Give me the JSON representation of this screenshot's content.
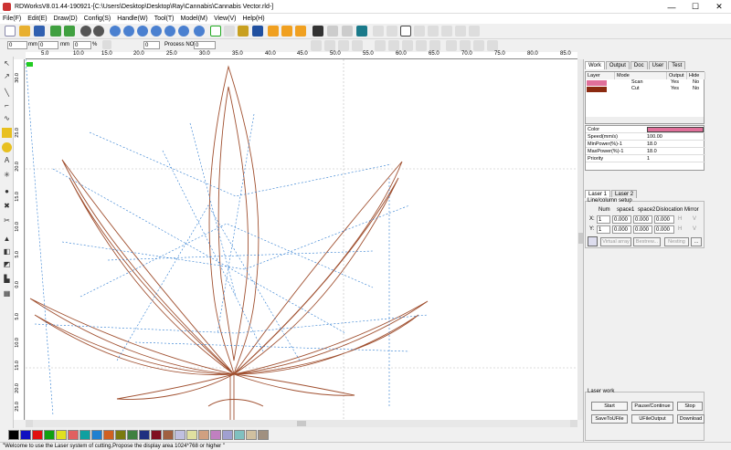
{
  "window": {
    "title": "RDWorksV8.01.44-190921-[C:\\Users\\Desktop\\Desktop\\Ray\\Cannabis\\Cannabis Vector.rld-]",
    "minimize": "—",
    "maximize": "☐",
    "close": "✕"
  },
  "menu": [
    "File(F)",
    "Edit(E)",
    "Draw(D)",
    "Config(S)",
    "Handle(W)",
    "Tool(T)",
    "Model(M)",
    "View(V)",
    "Help(H)"
  ],
  "toolbar2": {
    "unit_mm": "mm",
    "pct": "%",
    "x": "0",
    "y": "0",
    "w": "0",
    "h": "0",
    "wp": "0",
    "hp": "0",
    "angle": "0",
    "process_no_label": "Process NO:",
    "process_no": "0"
  },
  "ruler": {
    "h": [
      "5.0",
      "10.0",
      "15.0",
      "20.0",
      "25.0",
      "30.0",
      "35.0",
      "40.0",
      "45.0",
      "50.0",
      "55.0",
      "60.0",
      "65.0",
      "70.0",
      "75.0",
      "80.0",
      "85.0"
    ],
    "v": [
      "25.0",
      "20.0",
      "15.0",
      "10.0",
      "5.0",
      "0.0",
      "5.0",
      "10.0",
      "15.0",
      "20.0",
      "25.0",
      "30.0"
    ]
  },
  "panel": {
    "tabs": [
      "Work",
      "Output",
      "Doc",
      "User",
      "Test"
    ],
    "layer_headers": [
      "Layer",
      "Mode",
      "Output",
      "Hide"
    ],
    "layers": [
      {
        "mode": "Scan",
        "output": "Yes",
        "hide": "No",
        "color": "#e0709a"
      },
      {
        "mode": "Cut",
        "output": "Yes",
        "hide": "No",
        "color": "#8b2a10"
      }
    ],
    "props": [
      {
        "k": "Color",
        "v": ""
      },
      {
        "k": "Speed(mm/s)",
        "v": "100.00"
      },
      {
        "k": "MinPower(%)-1",
        "v": "18.0"
      },
      {
        "k": "MaxPower(%)-1",
        "v": "18.0"
      },
      {
        "k": "Priority",
        "v": "1"
      }
    ],
    "laser_tabs": [
      "Laser 1",
      "Laser 2"
    ],
    "linecol": {
      "title": "Line/column setup",
      "headers": [
        "Num",
        "space1",
        "space2",
        "Dislocation",
        "Mirror"
      ],
      "x_label": "X:",
      "y_label": "Y:",
      "x_num": "1",
      "x_s1": "0.000",
      "x_s2": "0.000",
      "x_dis": "0.000",
      "x_mirror": "H",
      "y_num": "1",
      "y_s1": "0.000",
      "y_s2": "0.000",
      "y_dis": "0.000",
      "y_mirror": "H",
      "x_mirror2": "V",
      "y_mirror2": "V",
      "btn_virtual": "Virtual array",
      "btn_bestrew": "Bestrew...",
      "btn_nesting": "Nesting",
      "btn_more": "..."
    },
    "laser_work": {
      "title": "Laser work",
      "start": "Start",
      "pause": "Pause/Continue",
      "stop": "Stop",
      "save": "SaveToUFile",
      "uoutput": "UFileOutput",
      "download": "Download"
    }
  },
  "palette": [
    "#000000",
    "#1010c0",
    "#e01010",
    "#10a010",
    "#e0e020",
    "#e06060",
    "#10a0a0",
    "#2080d0",
    "#d06020",
    "#7a7a10",
    "#408040",
    "#203080",
    "#801020",
    "#a06040",
    "#c0c0e0",
    "#e0e0a0",
    "#d0a080",
    "#c080c0",
    "#a0a0d0",
    "#80c0c0",
    "#d0c0a0",
    "#a09080"
  ],
  "status": "\"Welcome to use the Laser system of cutting,Propose the display area 1024*768 or higher \""
}
